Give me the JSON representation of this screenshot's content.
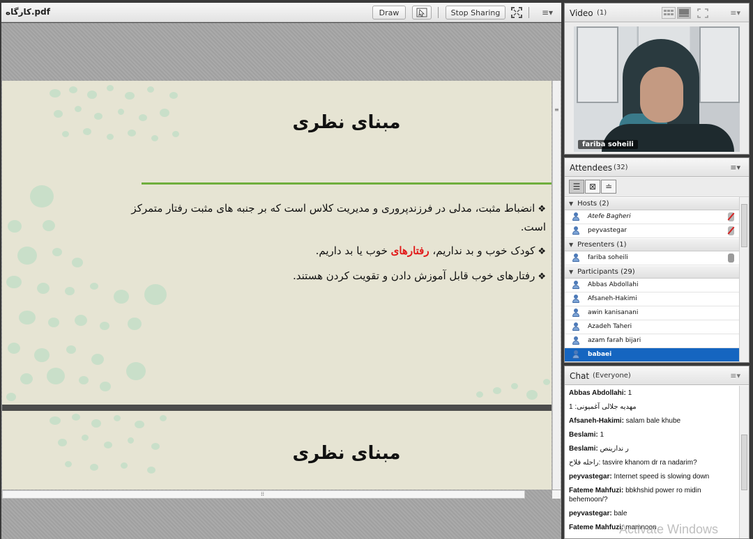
{
  "share": {
    "title": "کارگاه.pdf",
    "draw_label": "Draw",
    "stop_label": "Stop Sharing",
    "menu_glyph": "≡▾"
  },
  "slides": [
    {
      "title": "مبنای نظری",
      "bullets": [
        {
          "parts": [
            "انضباط مثبت، مدلی در فرزندپروری و مدیریت کلاس است که بر جنبه های مثبت رفتار متمرکز",
            "است."
          ]
        },
        {
          "before": "کودک خوب و بد نداریم، ",
          "highlight": "رفتارهای",
          "after": " خوب یا بد داریم."
        },
        {
          "text": "رفتارهای خوب قابل آموزش دادن و تقویت کردن هستند."
        }
      ]
    },
    {
      "title": "مبنای نظری"
    }
  ],
  "video": {
    "title": "Video",
    "count": "(1)",
    "participant_name": "fariba soheili"
  },
  "attendees": {
    "title": "Attendees",
    "count": "(32)",
    "sections": [
      {
        "label": "Hosts (2)",
        "rows": [
          {
            "name": "Atefe Bagheri",
            "italic": true,
            "mic": "off"
          },
          {
            "name": "peyvastegar",
            "italic": false,
            "mic": "off"
          }
        ]
      },
      {
        "label": "Presenters (1)",
        "rows": [
          {
            "name": "fariba soheili",
            "italic": false,
            "mic": "on"
          }
        ]
      },
      {
        "label": "Participants (29)",
        "rows": [
          {
            "name": "Abbas Abdollahi"
          },
          {
            "name": "Afsaneh-Hakimi"
          },
          {
            "name": "awin kanisanani"
          },
          {
            "name": "Azadeh Taheri"
          },
          {
            "name": "azam farah bijari"
          },
          {
            "name": "babaei",
            "selected": true
          }
        ]
      }
    ]
  },
  "chat": {
    "title": "Chat",
    "scope": "(Everyone)",
    "messages": [
      {
        "author": "Abbas Abdollahi:",
        "text": " 1"
      },
      {
        "author": "",
        "text": "مهدیه جلالی آغمیونی: 1"
      },
      {
        "author": "Afsaneh-Hakimi:",
        "text": " salam bale khube"
      },
      {
        "author": "Beslami:",
        "text": " 1"
      },
      {
        "author": "Beslami:",
        "text": " ر ندارینص"
      },
      {
        "author": "",
        "text": "راحله فلاح: tasvire khanom dr ra nadarim?"
      },
      {
        "author": "peyvastegar:",
        "text": " Internet speed is slowing down"
      },
      {
        "author": "Fateme Mahfuzi:",
        "text": " bbkhshid power ro midin behemoon/?"
      },
      {
        "author": "peyvastegar:",
        "text": " bale"
      },
      {
        "author": "Fateme Mahfuzi:",
        "text": " mamnoon"
      }
    ]
  },
  "watermark": "Activate Windows"
}
